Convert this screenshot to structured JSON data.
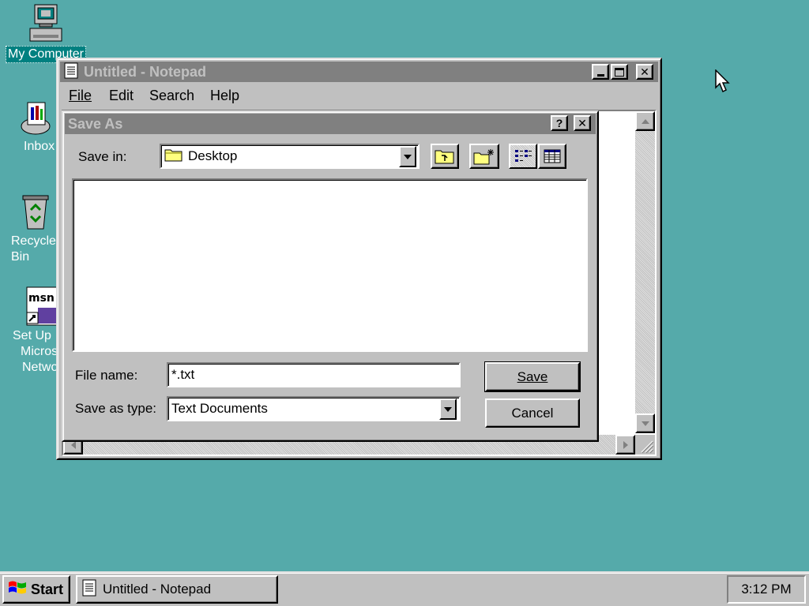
{
  "desktop": {
    "icons": [
      {
        "label": "My Computer"
      },
      {
        "label": "Inbox"
      },
      {
        "label": "Recycle Bin"
      },
      {
        "label_lines": [
          "Set Up",
          "Micros",
          "Netwo"
        ]
      }
    ]
  },
  "notepad": {
    "title": "Untitled - Notepad",
    "menu": [
      "File",
      "Edit",
      "Search",
      "Help"
    ]
  },
  "dialog": {
    "title": "Save As",
    "help_btn": "?",
    "close_btn": "✕",
    "save_in_label": "Save in:",
    "save_in_value": "Desktop",
    "file_name_label": "File name:",
    "file_name_value": "*.txt",
    "save_as_type_label": "Save as type:",
    "save_as_type_value": "Text Documents",
    "save_button": "Save",
    "cancel_button": "Cancel"
  },
  "taskbar": {
    "start_label": "Start",
    "task_label": "Untitled - Notepad",
    "clock": "3:12 PM"
  },
  "colors": {
    "desktop": "#55aaaa",
    "inactive_title": "#808080",
    "face": "#c0c0c0"
  }
}
